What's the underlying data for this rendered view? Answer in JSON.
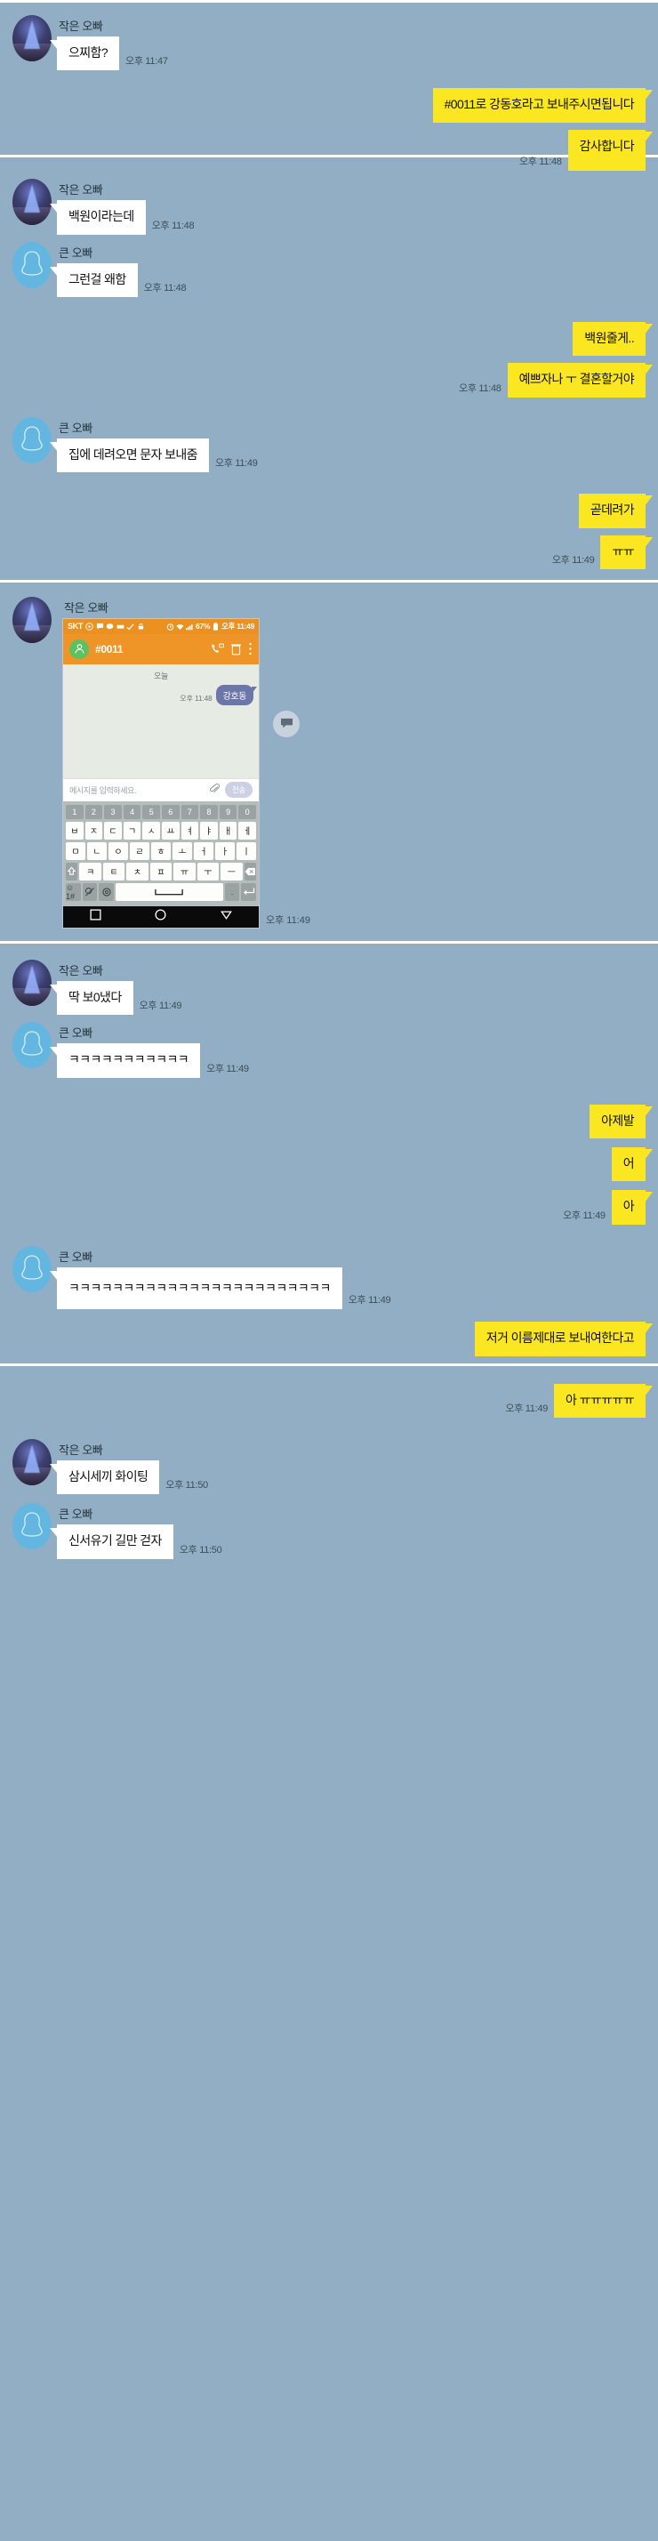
{
  "app": {
    "background_color": "#92aec4",
    "bubble_in_color": "#ffffff",
    "bubble_out_color": "#fbe721"
  },
  "senders": {
    "small_brother": "작은 오빠",
    "big_brother": "큰 오빠"
  },
  "sections": [
    {
      "messages": [
        {
          "side": "left",
          "sender": "작은 오빠",
          "avatar": "tree",
          "text": "으찌함?",
          "time": "오후 11:47"
        },
        {
          "side": "right",
          "text": "#0011로 강동호라고 보내주시면됩니다",
          "time": ""
        },
        {
          "side": "right",
          "text": "감사합니다",
          "time": "오후 11:48"
        }
      ]
    },
    {
      "messages": [
        {
          "side": "left",
          "sender": "작은 오빠",
          "avatar": "tree",
          "text": "백원이라는데",
          "time": "오후 11:48"
        },
        {
          "side": "left",
          "sender": "큰 오빠",
          "avatar": "person",
          "text": "그런걸 왜함",
          "time": "오후 11:48"
        },
        {
          "side": "right",
          "text": "백원줄게..",
          "time": ""
        },
        {
          "side": "right",
          "text": "예쁘자나 ㅜ 결혼할거야",
          "time": "오후 11:48"
        },
        {
          "side": "left",
          "sender": "큰 오빠",
          "avatar": "person",
          "text": "집에 데려오면 문자 보내줌",
          "time": "오후 11:49"
        },
        {
          "side": "right",
          "text": "곧데려가",
          "time": ""
        },
        {
          "side": "right",
          "text": "ㅠㅠ",
          "time": "오후 11:49"
        }
      ],
      "photo_message": {
        "sender": "작은 오빠",
        "avatar": "tree",
        "time": "오후 11:49",
        "phone": {
          "status": {
            "carrier": "SKT",
            "icons": [
              "play-circle-icon",
              "message-icon",
              "chat-icon",
              "keyboard-icon",
              "check-icon",
              "lock-icon",
              "alarm-icon",
              "wifi-icon",
              "signal-icon"
            ],
            "battery": "67%",
            "clock": "오후 11:49"
          },
          "appbar": {
            "title": "#0011",
            "actions": [
              "video-call-icon",
              "trash-icon",
              "overflow-menu-icon"
            ]
          },
          "thread": {
            "date_label": "오늘",
            "messages": [
              {
                "side": "right",
                "text": "강호동",
                "time": "오후 11:48"
              }
            ]
          },
          "composer": {
            "placeholder": "메시지를 입력하세요.",
            "attach_icon": "paperclip-icon",
            "send_label": "전송"
          },
          "keyboard": {
            "numbers": [
              "1",
              "2",
              "3",
              "4",
              "5",
              "6",
              "7",
              "8",
              "9",
              "0"
            ],
            "row1": [
              "ㅂ",
              "ㅈ",
              "ㄷ",
              "ㄱ",
              "ㅅ",
              "ㅛ",
              "ㅕ",
              "ㅑ",
              "ㅐ",
              "ㅔ"
            ],
            "row2": [
              "ㅁ",
              "ㄴ",
              "ㅇ",
              "ㄹ",
              "ㅎ",
              "ㅗ",
              "ㅓ",
              "ㅏ",
              "ㅣ"
            ],
            "row3_shift": "shift-icon",
            "row3": [
              "ㅋ",
              "ㅌ",
              "ㅊ",
              "ㅍ",
              "ㅠ",
              "ㅜ",
              "ㅡ"
            ],
            "row3_backspace": "backspace-icon",
            "row4": [
              "☺1#",
              "emoji-slash-key",
              "settings-gear-icon",
              "space-key",
              "period-key",
              "enter-icon"
            ]
          },
          "navbar": [
            "recents-square-icon",
            "home-circle-icon",
            "back-triangle-icon"
          ]
        }
      }
    },
    {
      "messages": [
        {
          "side": "left",
          "sender": "작은 오빠",
          "avatar": "tree",
          "text": "딱 보0냈다",
          "time": "오후 11:49"
        },
        {
          "side": "left",
          "sender": "큰 오빠",
          "avatar": "person",
          "text": "ㅋㅋㅋㅋㅋㅋㅋㅋㅋㅋㅋ",
          "time": "오후 11:49"
        },
        {
          "side": "right",
          "text": "아제발",
          "time": ""
        },
        {
          "side": "right",
          "text": "어",
          "time": ""
        },
        {
          "side": "right",
          "text": "아",
          "time": "오후 11:49"
        },
        {
          "side": "left",
          "sender": "큰 오빠",
          "avatar": "person",
          "text": "ㅋㅋㅋㅋㅋㅋㅋㅋㅋㅋㅋㅋㅋㅋㅋㅋㅋㅋㅋㅋㅋㅋㅋㅋ",
          "time": "오후 11:49"
        },
        {
          "side": "right",
          "text": "저거 이름제대로 보내여한다고",
          "time": ""
        }
      ]
    },
    {
      "messages": [
        {
          "side": "right",
          "text": "아 ㅠㅠㅠㅠㅠ",
          "time": "오후 11:49"
        },
        {
          "side": "left",
          "sender": "작은 오빠",
          "avatar": "tree",
          "text": "삼시세끼 화이팅",
          "time": "오후 11:50"
        },
        {
          "side": "left",
          "sender": "큰 오빠",
          "avatar": "person",
          "text": "신서유기 길만 걷자",
          "time": "오후 11:50"
        }
      ]
    }
  ]
}
